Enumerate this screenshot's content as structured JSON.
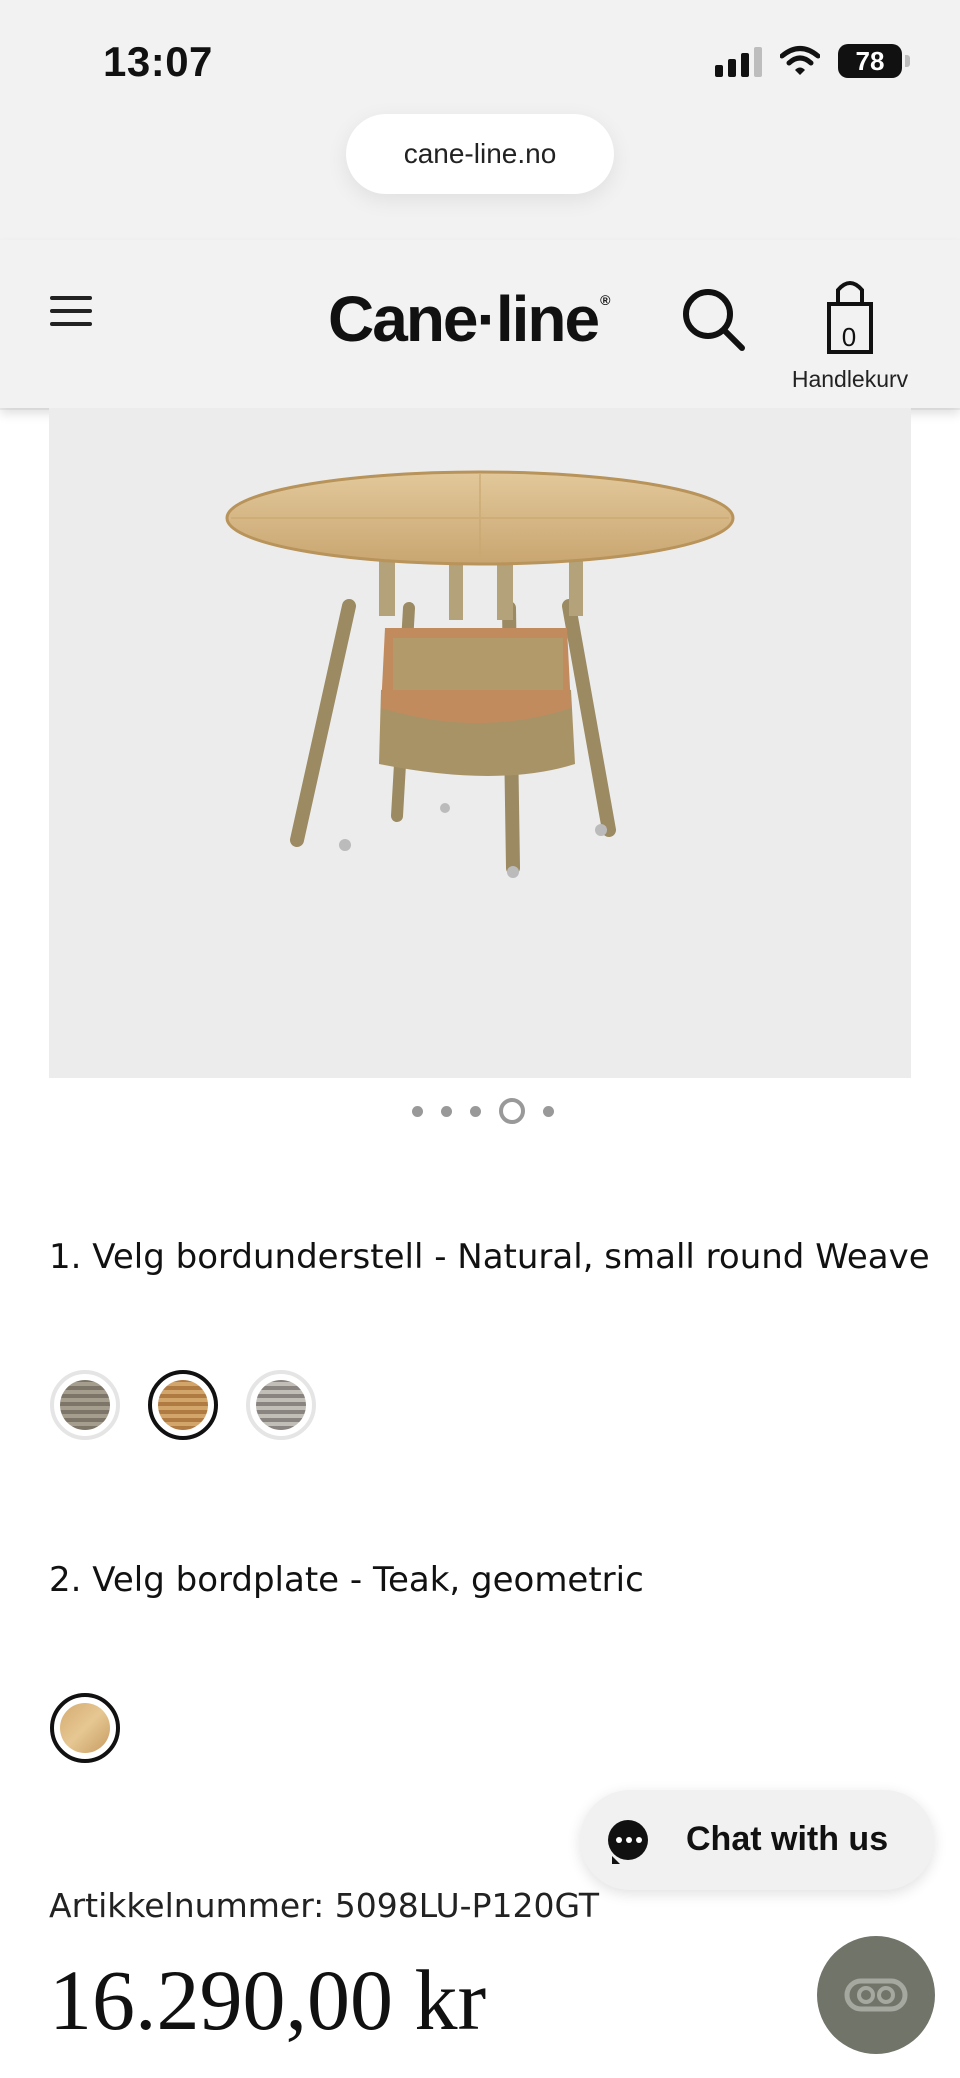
{
  "status_bar": {
    "time": "13:07",
    "battery": "78"
  },
  "browser": {
    "url": "cane-line.no"
  },
  "header": {
    "logo": "Cane·line",
    "logo_mark": "®",
    "cart_count": "0",
    "cart_label": "Handlekurv"
  },
  "gallery": {
    "dots": 5,
    "active_dot": 4
  },
  "options": [
    {
      "title": "1. Velg bordunderstell - Natural, small round Weave"
    },
    {
      "title": "2. Velg bordplate - Teak, geometric"
    }
  ],
  "chat": {
    "label": "Chat with us"
  },
  "product": {
    "article_number": "Artikkelnummer: 5098LU-P120GT",
    "price": "16.290,00 kr"
  },
  "colors": {
    "header_bg": "#f2f2f2",
    "image_bg": "#ececec",
    "fab": "#707469"
  },
  "icons": [
    "signal-icon",
    "wifi-icon",
    "battery-icon",
    "menu-icon",
    "search-icon",
    "cart-bag-icon",
    "chat-icon",
    "chat-launcher-icon"
  ]
}
